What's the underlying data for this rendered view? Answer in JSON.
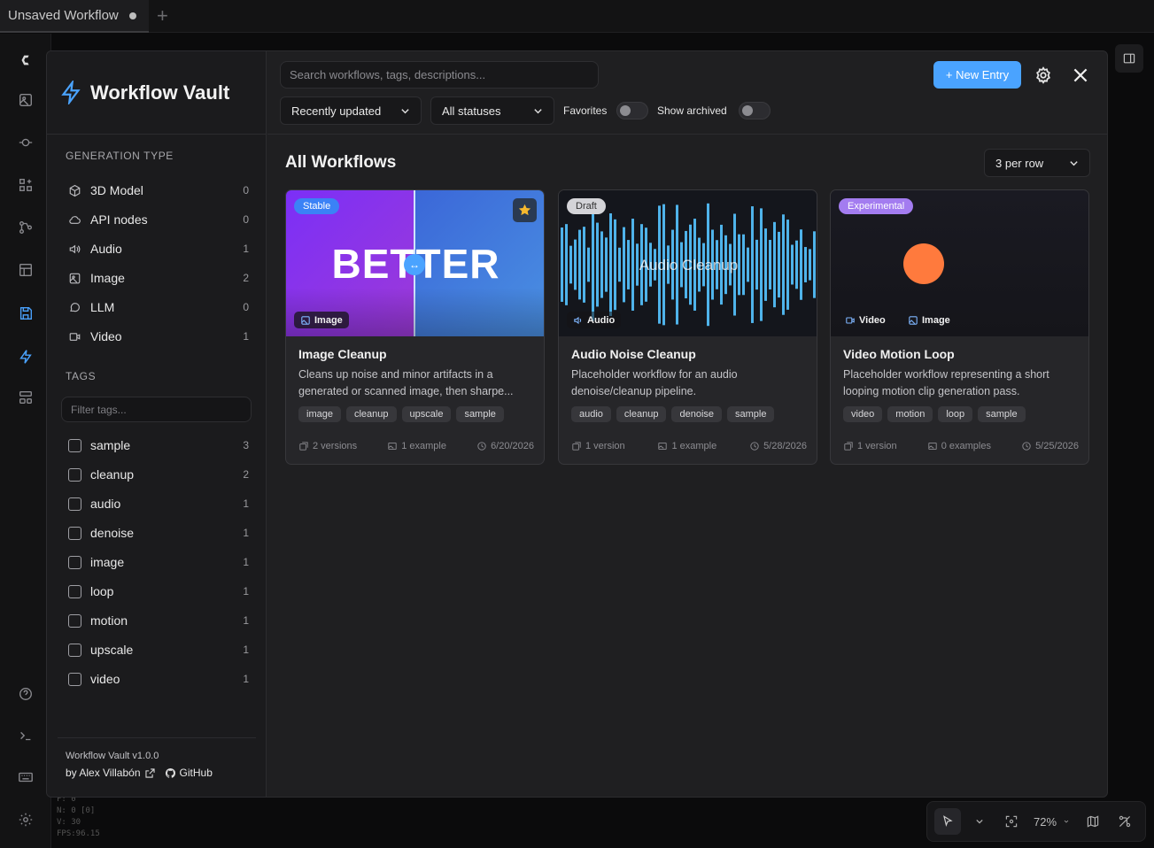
{
  "topbar": {
    "tab_title": "Unsaved Workflow",
    "new_tab": "+"
  },
  "canvas_stats": {
    "line1": "F: 0",
    "line2": "N: 0 [0]",
    "line3": "V: 30",
    "line4": "FPS:96.15"
  },
  "bottom_controls": {
    "zoom": "72%"
  },
  "vault": {
    "title": "Workflow Vault",
    "search_placeholder": "Search workflows, tags, descriptions...",
    "new_entry_label": "+ New Entry",
    "sort_value": "Recently updated",
    "status_value": "All statuses",
    "favorites_label": "Favorites",
    "archived_label": "Show archived",
    "section_title": "All Workflows",
    "per_row_value": "3 per row",
    "gen_type_label": "GENERATION TYPE",
    "gen_types": [
      {
        "label": "3D Model",
        "count": "0",
        "icon": "cube-icon"
      },
      {
        "label": "API nodes",
        "count": "0",
        "icon": "cloud-icon"
      },
      {
        "label": "Audio",
        "count": "1",
        "icon": "speaker-icon"
      },
      {
        "label": "Image",
        "count": "2",
        "icon": "image-icon"
      },
      {
        "label": "LLM",
        "count": "0",
        "icon": "chat-icon"
      },
      {
        "label": "Video",
        "count": "1",
        "icon": "video-icon"
      }
    ],
    "tags_label": "TAGS",
    "tag_filter_placeholder": "Filter tags...",
    "tags": [
      {
        "label": "sample",
        "count": "3"
      },
      {
        "label": "cleanup",
        "count": "2"
      },
      {
        "label": "audio",
        "count": "1"
      },
      {
        "label": "denoise",
        "count": "1"
      },
      {
        "label": "image",
        "count": "1"
      },
      {
        "label": "loop",
        "count": "1"
      },
      {
        "label": "motion",
        "count": "1"
      },
      {
        "label": "upscale",
        "count": "1"
      },
      {
        "label": "video",
        "count": "1"
      }
    ],
    "footer_version": "Workflow Vault v1.0.0",
    "footer_author": "by Alex Villabón",
    "footer_github": "GitHub"
  },
  "cards": [
    {
      "status": "Stable",
      "status_color": "#3b82f6",
      "title": "Image Cleanup",
      "thumb_text": "BETTER",
      "type_chips": [
        "Image"
      ],
      "desc": "Cleans up noise and minor artifacts in a generated or scanned image, then sharpe...",
      "tags": [
        "image",
        "cleanup",
        "upscale",
        "sample"
      ],
      "versions": "2 versions",
      "examples": "1 example",
      "date": "6/20/2026"
    },
    {
      "status": "Draft",
      "status_color": "#d4d4d8",
      "title": "Audio Noise Cleanup",
      "thumb_text": "Audio Cleanup",
      "type_chips": [
        "Audio"
      ],
      "desc": "Placeholder workflow for an audio denoise/cleanup pipeline.",
      "tags": [
        "audio",
        "cleanup",
        "denoise",
        "sample"
      ],
      "versions": "1 version",
      "examples": "1 example",
      "date": "5/28/2026"
    },
    {
      "status": "Experimental",
      "status_color": "#a37cf0",
      "title": "Video Motion Loop",
      "type_chips": [
        "Video",
        "Image"
      ],
      "desc": "Placeholder workflow representing a short looping motion clip generation pass.",
      "tags": [
        "video",
        "motion",
        "loop",
        "sample"
      ],
      "versions": "1 version",
      "examples": "0 examples",
      "date": "5/25/2026"
    }
  ]
}
